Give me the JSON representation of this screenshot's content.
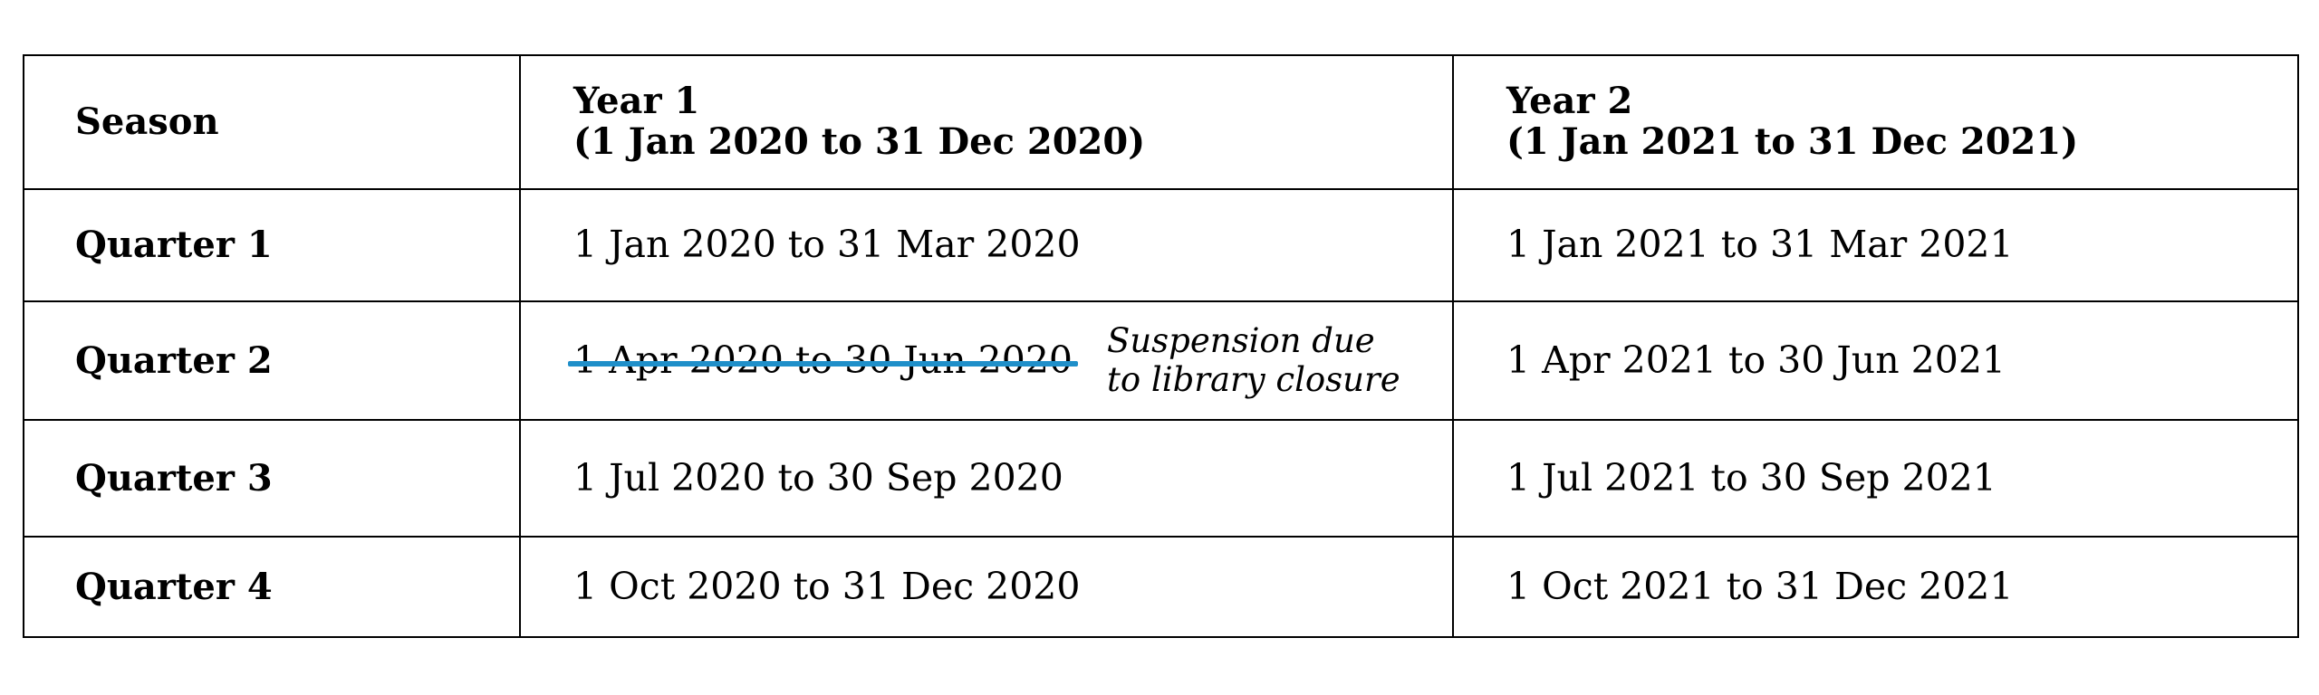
{
  "table": {
    "headers": {
      "season": "Season",
      "year1_title": "Year 1",
      "year1_range": "(1 Jan 2020 to 31 Dec 2020)",
      "year2_title": "Year 2",
      "year2_range": "(1 Jan 2021 to 31 Dec 2021)"
    },
    "rows": [
      {
        "season": "Quarter 1",
        "year1": "1 Jan 2020 to 31 Mar 2020",
        "year2": "1 Jan 2021 to 31 Mar 2021"
      },
      {
        "season": "Quarter 2",
        "year1": "1 Apr 2020 to 30 Jun 2020",
        "year1_struck": true,
        "year1_note": "Suspension due to library closure",
        "year2": "1 Apr 2021 to 30 Jun 2021"
      },
      {
        "season": "Quarter 3",
        "year1": "1 Jul 2020 to 30 Sep 2020",
        "year2": "1 Jul 2021 to 30 Sep 2021"
      },
      {
        "season": "Quarter 4",
        "year1": "1 Oct 2020 to 31 Dec 2020",
        "year2": "1 Oct 2021 to 31 Dec 2021"
      }
    ]
  },
  "colors": {
    "strikethrough": "#1f8fc9",
    "border": "#000000",
    "text": "#000000"
  }
}
